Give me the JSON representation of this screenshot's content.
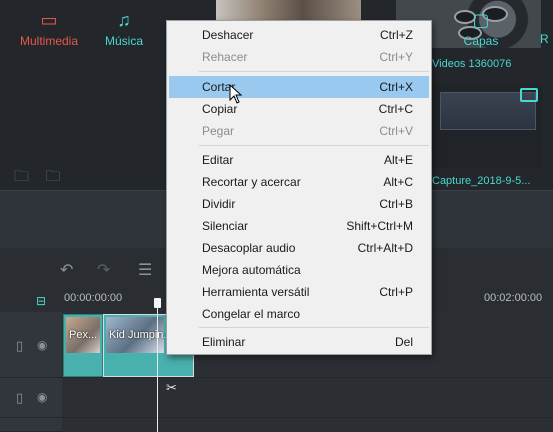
{
  "media": {
    "thumb_label_1": "Videos 1360076",
    "thumb_label_2": "Capture_2018-9-5..."
  },
  "tabs": {
    "multimedia": "Multimedia",
    "musica": "Música",
    "capas": "Capas",
    "partial": "R"
  },
  "timeline": {
    "time_start": "00:00:00:00",
    "time_end": "00:02:00:00",
    "clip1_label": "Pex...",
    "clip2_label": "Kid Jumpin..."
  },
  "menu": {
    "items": [
      {
        "label": "Deshacer",
        "shortcut": "Ctrl+Z",
        "disabled": false
      },
      {
        "label": "Rehacer",
        "shortcut": "Ctrl+Y",
        "disabled": true
      },
      {
        "label": "Cortar",
        "shortcut": "Ctrl+X",
        "disabled": false,
        "highlighted": true
      },
      {
        "label": "Copiar",
        "shortcut": "Ctrl+C",
        "disabled": false
      },
      {
        "label": "Pegar",
        "shortcut": "Ctrl+V",
        "disabled": true
      },
      {
        "label": "Editar",
        "shortcut": "Alt+E",
        "disabled": false
      },
      {
        "label": "Recortar y acercar",
        "shortcut": "Alt+C",
        "disabled": false
      },
      {
        "label": "Dividir",
        "shortcut": "Ctrl+B",
        "disabled": false
      },
      {
        "label": "Silenciar",
        "shortcut": "Shift+Ctrl+M",
        "disabled": false
      },
      {
        "label": "Desacoplar audio",
        "shortcut": "Ctrl+Alt+D",
        "disabled": false
      },
      {
        "label": "Mejora automática",
        "shortcut": "",
        "disabled": false
      },
      {
        "label": "Herramienta versátil",
        "shortcut": "Ctrl+P",
        "disabled": false
      },
      {
        "label": "Congelar el marco",
        "shortcut": "",
        "disabled": false
      },
      {
        "label": "Eliminar",
        "shortcut": "Del",
        "disabled": false
      }
    ]
  },
  "colors": {
    "accent": "#4ad7d1",
    "active_tab": "#e8574a",
    "menu_highlight": "#99c9ef"
  }
}
